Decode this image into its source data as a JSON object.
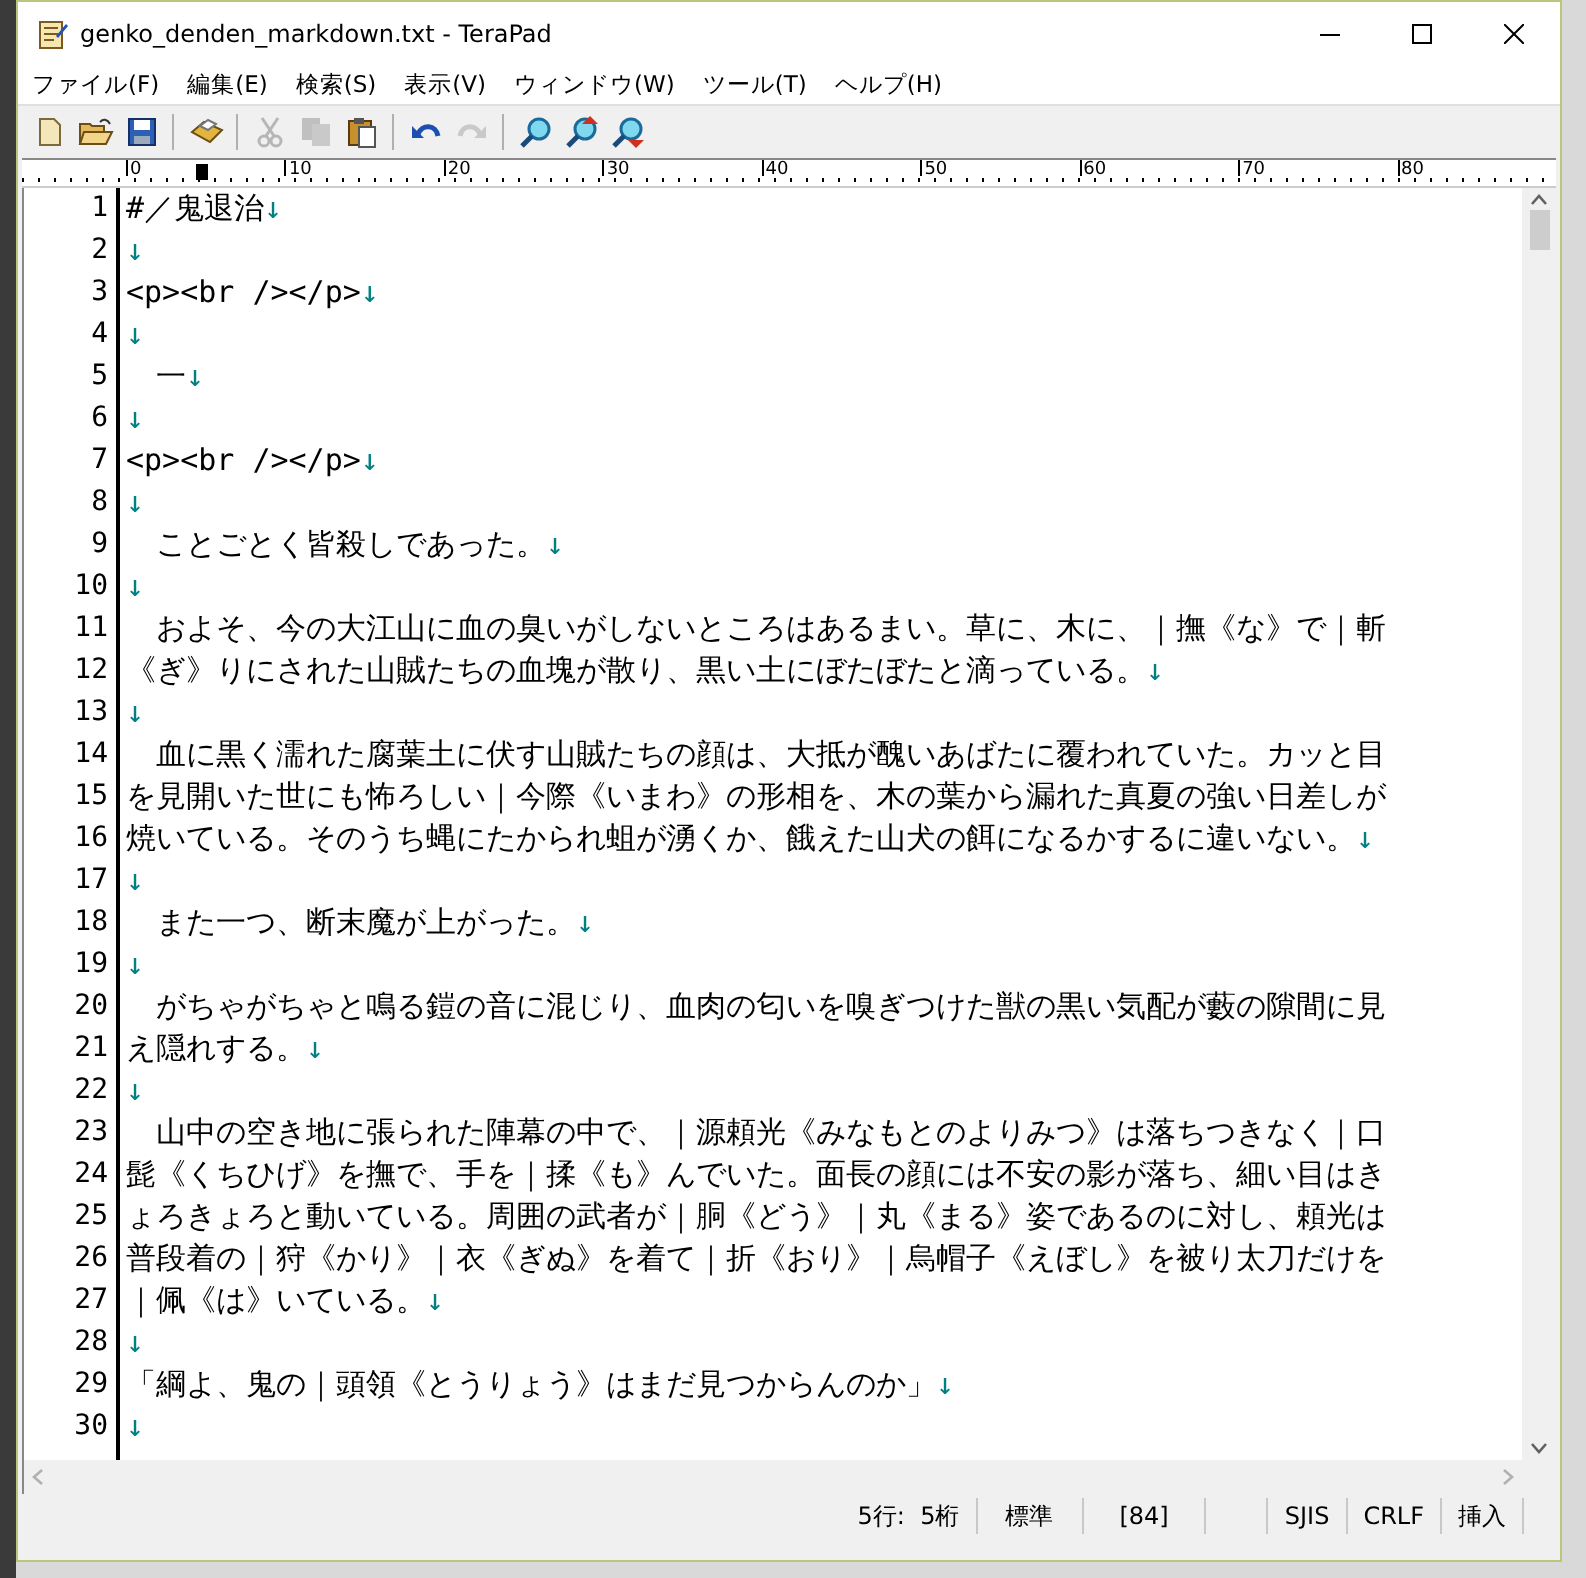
{
  "window": {
    "title": "genko_denden_markdown.txt - TeraPad"
  },
  "menu": [
    {
      "label": "ファイル(F)"
    },
    {
      "label": "編集(E)"
    },
    {
      "label": "検索(S)"
    },
    {
      "label": "表示(V)"
    },
    {
      "label": "ウィンドウ(W)"
    },
    {
      "label": "ツール(T)"
    },
    {
      "label": "ヘルプ(H)"
    }
  ],
  "toolbar": {
    "groups": [
      [
        {
          "kind": "new",
          "disabled": false
        },
        {
          "kind": "open",
          "disabled": false
        },
        {
          "kind": "save",
          "disabled": false
        }
      ],
      [
        {
          "kind": "print",
          "disabled": false
        }
      ],
      [
        {
          "kind": "cut",
          "disabled": true
        },
        {
          "kind": "copy",
          "disabled": true
        },
        {
          "kind": "paste",
          "disabled": false
        }
      ],
      [
        {
          "kind": "undo",
          "disabled": false
        },
        {
          "kind": "redo",
          "disabled": true
        }
      ],
      [
        {
          "kind": "find",
          "disabled": false
        },
        {
          "kind": "find-up",
          "disabled": false
        },
        {
          "kind": "find-down",
          "disabled": false
        }
      ]
    ]
  },
  "ruler": {
    "labels": [
      "0",
      "10",
      "20",
      "30",
      "40",
      "50",
      "60",
      "70",
      "80"
    ]
  },
  "editor": {
    "lines": [
      {
        "number": "1",
        "text": "#／鬼退治",
        "eol_mark": "↓"
      },
      {
        "number": "2",
        "eol_mark": "↓"
      },
      {
        "number": "3",
        "text": "<p><br /></p>",
        "eol_mark": "↓"
      },
      {
        "number": "4",
        "eol_mark": "↓"
      },
      {
        "number": "5",
        "text": "　一",
        "eol_mark": "↓"
      },
      {
        "number": "6",
        "eol_mark": "↓"
      },
      {
        "number": "7",
        "text": "<p><br /></p>",
        "eol_mark": "↓"
      },
      {
        "number": "8",
        "eol_mark": "↓"
      },
      {
        "number": "9",
        "text": "　ことごとく皆殺しであった。",
        "eol_mark": "↓"
      },
      {
        "number": "10",
        "eol_mark": "↓"
      },
      {
        "number": "11",
        "text": "　およそ、今の大江山に血の臭いがしないところはあるまい。草に、木に、｜撫《な》で｜斬"
      },
      {
        "number": "12",
        "text": "《ぎ》りにされた山賊たちの血塊が散り、黒い土にぼたぼたと滴っている。",
        "eol_mark": "↓"
      },
      {
        "number": "13",
        "eol_mark": "↓"
      },
      {
        "number": "14",
        "text": "　血に黒く濡れた腐葉土に伏す山賊たちの顔は、大抵が醜いあばたに覆われていた。カッと目"
      },
      {
        "number": "15",
        "text": "を見開いた世にも怖ろしい｜今際《いまわ》の形相を、木の葉から漏れた真夏の強い日差しが"
      },
      {
        "number": "16",
        "text": "焼いている。そのうち蝿にたかられ蛆が湧くか、餓えた山犬の餌になるかするに違いない。",
        "eol_mark": "↓"
      },
      {
        "number": "17",
        "eol_mark": "↓"
      },
      {
        "number": "18",
        "text": "　また一つ、断末魔が上がった。",
        "eol_mark": "↓"
      },
      {
        "number": "19",
        "eol_mark": "↓"
      },
      {
        "number": "20",
        "text": "　がちゃがちゃと鳴る鎧の音に混じり、血肉の匂いを嗅ぎつけた獣の黒い気配が藪の隙間に見"
      },
      {
        "number": "21",
        "text": "え隠れする。",
        "eol_mark": "↓"
      },
      {
        "number": "22",
        "eol_mark": "↓"
      },
      {
        "number": "23",
        "text": "　山中の空き地に張られた陣幕の中で、｜源頼光《みなもとのよりみつ》は落ちつきなく｜口"
      },
      {
        "number": "24",
        "text": "髭《くちひげ》を撫で、手を｜揉《も》んでいた。面長の顔には不安の影が落ち、細い目はき"
      },
      {
        "number": "25",
        "text": "ょろきょろと動いている。周囲の武者が｜胴《どう》｜丸《まる》姿であるのに対し、頼光は"
      },
      {
        "number": "26",
        "text": "普段着の｜狩《かり》｜衣《ぎぬ》を着て｜折《おり》｜烏帽子《えぼし》を被り太刀だけを"
      },
      {
        "number": "27",
        "text": "｜佩《は》いている。",
        "eol_mark": "↓"
      },
      {
        "number": "28",
        "eol_mark": "↓"
      },
      {
        "number": "29",
        "text": "「綱よ、鬼の｜頭領《とうりょう》はまだ見つからんのか」",
        "eol_mark": "↓"
      },
      {
        "number": "30",
        "eol_mark": "↓"
      }
    ]
  },
  "status_bar": {
    "fields": [
      "5行:  5桁",
      "標準",
      "[84]",
      "SJIS",
      "CRLF",
      "挿入"
    ]
  }
}
